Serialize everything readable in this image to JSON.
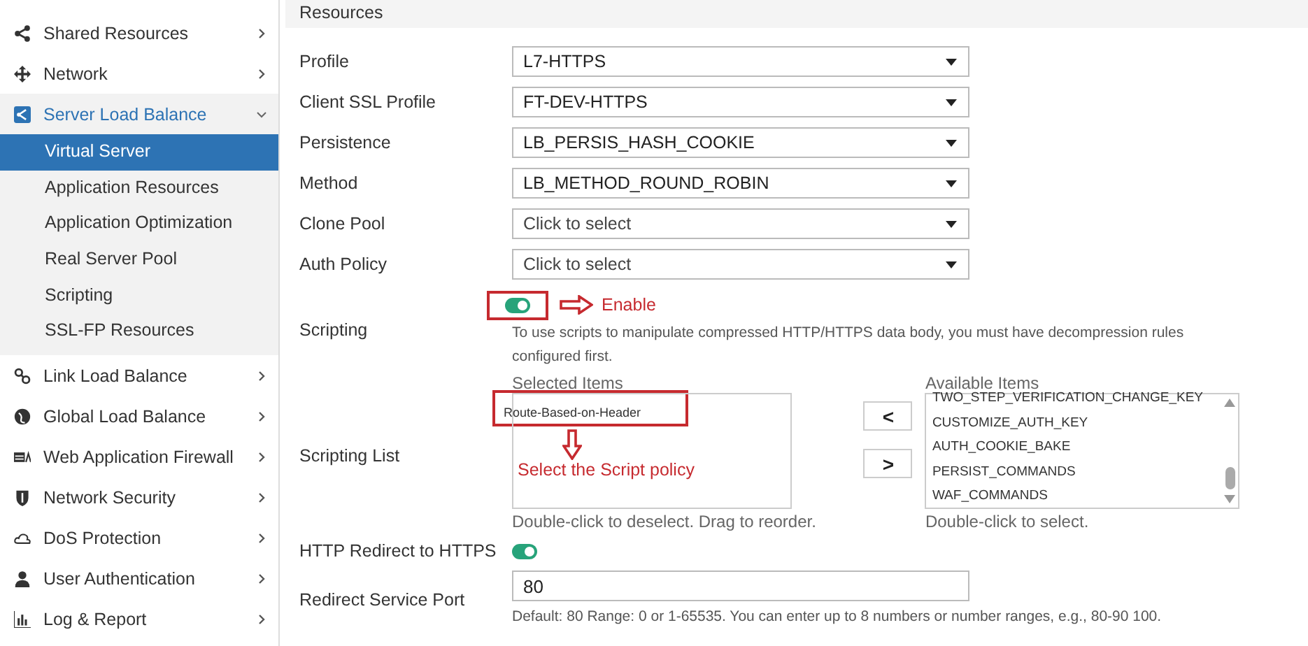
{
  "sidebar": {
    "items": [
      {
        "label": "Shared Resources",
        "expanded": false
      },
      {
        "label": "Network",
        "expanded": false
      },
      {
        "label": "Server Load Balance",
        "expanded": true,
        "children": [
          {
            "label": "Virtual Server",
            "selected": true
          },
          {
            "label": "Application Resources",
            "selected": false
          },
          {
            "label": "Application Optimization",
            "selected": false
          },
          {
            "label": "Real Server Pool",
            "selected": false
          },
          {
            "label": "Scripting",
            "selected": false
          },
          {
            "label": "SSL-FP Resources",
            "selected": false
          }
        ]
      },
      {
        "label": "Link Load Balance",
        "expanded": false
      },
      {
        "label": "Global Load Balance",
        "expanded": false
      },
      {
        "label": "Web Application Firewall",
        "expanded": false
      },
      {
        "label": "Network Security",
        "expanded": false
      },
      {
        "label": "DoS Protection",
        "expanded": false
      },
      {
        "label": "User Authentication",
        "expanded": false
      },
      {
        "label": "Log & Report",
        "expanded": false
      }
    ]
  },
  "section": {
    "title": "Resources"
  },
  "selects": [
    {
      "label": "Profile",
      "value": "L7-HTTPS",
      "placeholder": false
    },
    {
      "label": "Client SSL Profile",
      "value": "FT-DEV-HTTPS",
      "placeholder": false
    },
    {
      "label": "Persistence",
      "value": "LB_PERSIS_HASH_COOKIE",
      "placeholder": false
    },
    {
      "label": "Method",
      "value": "LB_METHOD_ROUND_ROBIN",
      "placeholder": false
    },
    {
      "label": "Clone Pool",
      "value": "Click to select",
      "placeholder": true
    },
    {
      "label": "Auth Policy",
      "value": "Click to select",
      "placeholder": true
    }
  ],
  "scripting": {
    "label": "Scripting",
    "on": true,
    "annotation": "Enable",
    "help": "To use scripts to manipulate compressed HTTP/HTTPS data body, you must have decompression rules configured first."
  },
  "scripting_list": {
    "label": "Scripting List",
    "selected_title": "Selected Items",
    "selected_items": [
      "Route-Based-on-Header"
    ],
    "selected_hint": "Double-click to deselect. Drag to reorder.",
    "annotation": "Select the Script policy",
    "move_left": "<",
    "move_right": ">",
    "available_title": "Available Items",
    "available_items": [
      "TWO_STEP_VERIFICATION_CHANGE_KEY",
      "CUSTOMIZE_AUTH_KEY",
      "AUTH_COOKIE_BAKE",
      "PERSIST_COMMANDS",
      "WAF_COMMANDS"
    ],
    "available_hint": "Double-click to select."
  },
  "http_redirect": {
    "label": "HTTP Redirect to HTTPS",
    "on": true
  },
  "redirect_port": {
    "label": "Redirect Service Port",
    "value": "80",
    "hint": "Default: 80 Range: 0 or 1-65535. You can enter up to 8 numbers or number ranges, e.g., 80-90 100."
  }
}
